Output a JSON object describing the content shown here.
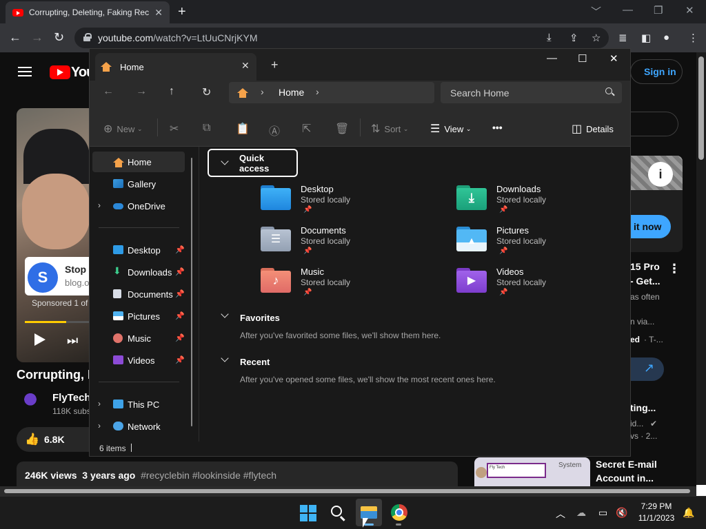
{
  "browser": {
    "tab_title": "Corrupting, Deleting, Faking Rec",
    "tab_close": "✕",
    "new_tab": "+",
    "url_host": "youtube.com",
    "url_path": "/watch?v=LtUuCNrjKYM"
  },
  "youtube": {
    "logo_text": "You",
    "sign_in": "Sign in",
    "ad_title": "Stop",
    "ad_domain": "blog.o",
    "ad_icon_letter": "S",
    "sponsored": "Sponsored 1 of",
    "video_title": "Corrupting, D",
    "channel_name": "FlyTech",
    "channel_subs": "118K subs",
    "likes": "6.8K",
    "views": "246K views",
    "age": "3 years ago",
    "hashtags": "#recyclebin #lookinside #flytech",
    "ad_info_glyph": "i",
    "ad_cta": "it now",
    "side_title_1": "15 Pro",
    "side_title_2": "- Get...",
    "side_meta_1": "as often",
    "side_meta_2": "n via...",
    "side_meta_3": "ed",
    "side_meta_4": "· T-...",
    "side_title_3": "ting...",
    "side_meta_5": "id...",
    "side_meta_6": "vs · 2...",
    "next_video_title_1": "Secret E-mail",
    "next_video_title_2": "Account in...",
    "thumb_text": "Fly Tech",
    "thumb_system": "System"
  },
  "explorer": {
    "tab_title": "Home",
    "breadcrumb": "Home",
    "search_placeholder": "Search Home",
    "commands": {
      "new": "New",
      "sort": "Sort",
      "view": "View",
      "more": "•••",
      "details": "Details"
    },
    "nav": [
      {
        "label": "Home"
      },
      {
        "label": "Gallery"
      },
      {
        "label": "OneDrive"
      },
      {
        "label": "Desktop"
      },
      {
        "label": "Downloads"
      },
      {
        "label": "Documents"
      },
      {
        "label": "Pictures"
      },
      {
        "label": "Music"
      },
      {
        "label": "Videos"
      },
      {
        "label": "This PC"
      },
      {
        "label": "Network"
      }
    ],
    "quick_access": {
      "header": "Quick access",
      "items": [
        {
          "name": "Desktop",
          "sub": "Stored locally"
        },
        {
          "name": "Downloads",
          "sub": "Stored locally"
        },
        {
          "name": "Documents",
          "sub": "Stored locally"
        },
        {
          "name": "Pictures",
          "sub": "Stored locally"
        },
        {
          "name": "Music",
          "sub": "Stored locally"
        },
        {
          "name": "Videos",
          "sub": "Stored locally"
        }
      ]
    },
    "favorites": {
      "header": "Favorites",
      "empty_text": "After you've favorited some files, we'll show them here."
    },
    "recent": {
      "header": "Recent",
      "empty_text": "After you've opened some files, we'll show the most recent ones here."
    },
    "status": "6 items"
  },
  "taskbar": {
    "time": "7:29 PM",
    "date": "11/1/2023"
  },
  "icons": {
    "play": "play-icon",
    "next": "skip-next-icon",
    "pin": "pin-icon"
  }
}
